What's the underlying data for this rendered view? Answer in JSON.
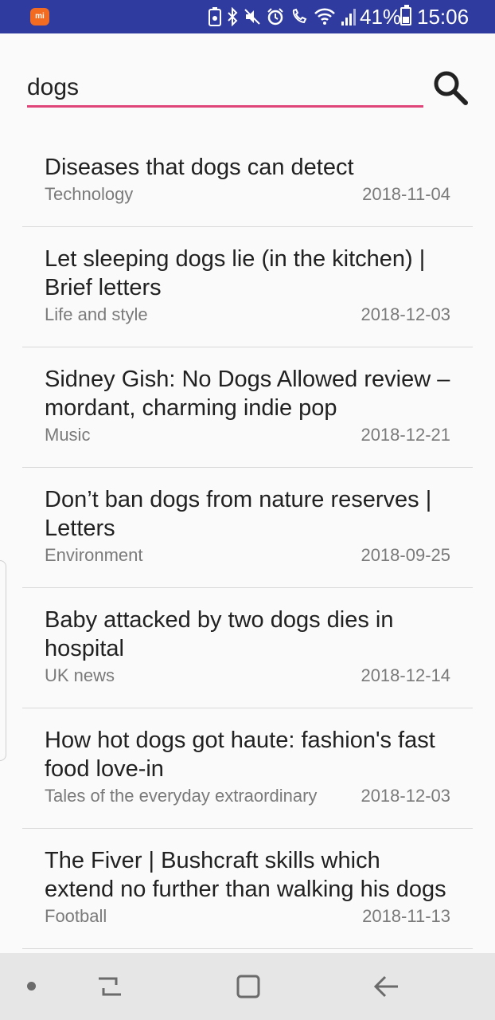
{
  "statusbar": {
    "battery_percent": "41%",
    "battery_level": 0.41,
    "time": "15:06",
    "icons": [
      "mi-app-icon",
      "battery-saver-icon",
      "bluetooth-icon",
      "mute-icon",
      "alarm-icon",
      "wifi-calling-icon",
      "wifi-icon",
      "signal-icon"
    ]
  },
  "search": {
    "value": "dogs",
    "accent_color": "#e0457a"
  },
  "results": [
    {
      "title": "Diseases that dogs can detect",
      "section": "Technology",
      "date": "2018-11-04"
    },
    {
      "title": "Let sleeping dogs lie (in the kitchen) | Brief letters",
      "section": "Life and style",
      "date": "2018-12-03"
    },
    {
      "title": "Sidney Gish: No Dogs Allowed review – mordant, charming indie pop",
      "section": "Music",
      "date": "2018-12-21"
    },
    {
      "title": "Don’t ban dogs from nature reserves | Letters",
      "section": "Environment",
      "date": "2018-09-25"
    },
    {
      "title": "Baby attacked by two dogs dies in hospital",
      "section": "UK news",
      "date": "2018-12-14"
    },
    {
      "title": "How hot dogs got haute: fashion's fast food love-in",
      "section": "Tales of the everyday extraordinary",
      "date": "2018-12-03"
    },
    {
      "title": "The Fiver | Bushcraft skills which extend no further than walking his dogs",
      "section": "Football",
      "date": "2018-11-13"
    }
  ],
  "colors": {
    "statusbar": "#2f3b9e",
    "background": "#fafafa",
    "navbar": "#e6e6e6"
  }
}
